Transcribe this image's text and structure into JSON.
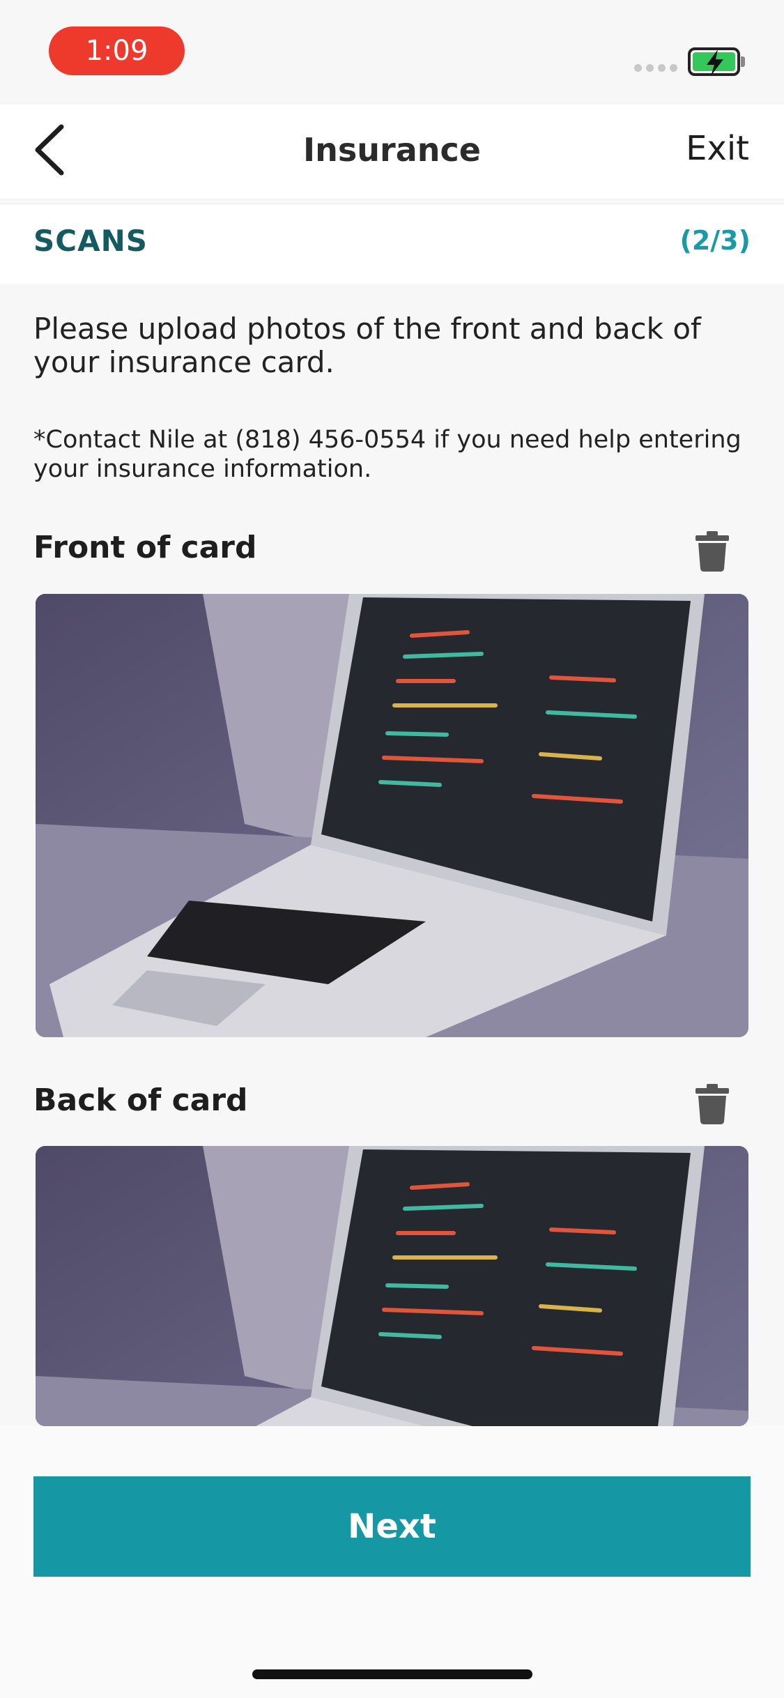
{
  "status_bar": {
    "time": "1:09",
    "battery_color": "#34c759"
  },
  "header": {
    "title": "Insurance",
    "exit_label": "Exit",
    "back_icon": "chevron-left-icon"
  },
  "section": {
    "title": "SCANS",
    "count": "(2/3)"
  },
  "content": {
    "intro": "Please upload photos of the front and back of your insurance card.",
    "note": "*Contact Nile at (818) 456-0554 if you need help entering your insurance information."
  },
  "cards": [
    {
      "label": "Front of card",
      "icon": "trash-icon",
      "photo": "laptop-photo"
    },
    {
      "label": "Back of card",
      "icon": "trash-icon",
      "photo": "laptop-photo"
    }
  ],
  "footer": {
    "next_label": "Next"
  },
  "colors": {
    "accent": "#1598a4",
    "section_title": "#135a61",
    "time_pill": "#ee3a2c"
  }
}
